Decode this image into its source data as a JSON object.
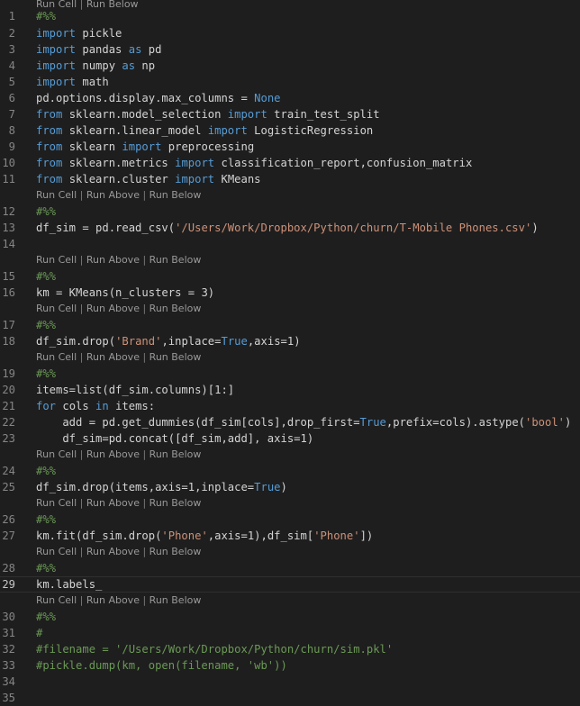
{
  "codelens": {
    "run_cell": "Run Cell",
    "run_above": "Run Above",
    "run_below": "Run Below",
    "separator": " | "
  },
  "lines": [
    {
      "n": "1",
      "toks": [
        {
          "t": "#%%",
          "c": "cm"
        }
      ]
    },
    {
      "n": "2",
      "toks": [
        {
          "t": "import",
          "c": "kw"
        },
        {
          "t": " pickle",
          "c": "plain"
        }
      ]
    },
    {
      "n": "3",
      "toks": [
        {
          "t": "import",
          "c": "kw"
        },
        {
          "t": " pandas ",
          "c": "plain"
        },
        {
          "t": "as",
          "c": "kw"
        },
        {
          "t": " pd",
          "c": "plain"
        }
      ]
    },
    {
      "n": "4",
      "toks": [
        {
          "t": "import",
          "c": "kw"
        },
        {
          "t": " numpy ",
          "c": "plain"
        },
        {
          "t": "as",
          "c": "kw"
        },
        {
          "t": " np",
          "c": "plain"
        }
      ]
    },
    {
      "n": "5",
      "toks": [
        {
          "t": "import",
          "c": "kw"
        },
        {
          "t": " math",
          "c": "plain"
        }
      ]
    },
    {
      "n": "6",
      "toks": [
        {
          "t": "pd.options.display.max_columns = ",
          "c": "plain"
        },
        {
          "t": "None",
          "c": "kw"
        }
      ]
    },
    {
      "n": "7",
      "toks": [
        {
          "t": "from",
          "c": "kw"
        },
        {
          "t": " sklearn.model_selection ",
          "c": "plain"
        },
        {
          "t": "import",
          "c": "kw"
        },
        {
          "t": " train_test_split",
          "c": "plain"
        }
      ]
    },
    {
      "n": "8",
      "toks": [
        {
          "t": "from",
          "c": "kw"
        },
        {
          "t": " sklearn.linear_model ",
          "c": "plain"
        },
        {
          "t": "import",
          "c": "kw"
        },
        {
          "t": " LogisticRegression",
          "c": "plain"
        }
      ]
    },
    {
      "n": "9",
      "toks": [
        {
          "t": "from",
          "c": "kw"
        },
        {
          "t": " sklearn ",
          "c": "plain"
        },
        {
          "t": "import",
          "c": "kw"
        },
        {
          "t": " preprocessing",
          "c": "plain"
        }
      ]
    },
    {
      "n": "10",
      "toks": [
        {
          "t": "from",
          "c": "kw"
        },
        {
          "t": " sklearn.metrics ",
          "c": "plain"
        },
        {
          "t": "import",
          "c": "kw"
        },
        {
          "t": " classification_report,confusion_matrix",
          "c": "plain"
        }
      ]
    },
    {
      "n": "11",
      "toks": [
        {
          "t": "from",
          "c": "kw"
        },
        {
          "t": " sklearn.cluster ",
          "c": "plain"
        },
        {
          "t": "import",
          "c": "kw"
        },
        {
          "t": " KMeans",
          "c": "plain"
        }
      ]
    },
    {
      "n": "12",
      "toks": [
        {
          "t": "#%%",
          "c": "cm"
        }
      ]
    },
    {
      "n": "13",
      "toks": [
        {
          "t": "df_sim = pd.read_csv(",
          "c": "plain"
        },
        {
          "t": "'/Users/Work/Dropbox/Python/churn/T-Mobile Phones.csv'",
          "c": "str"
        },
        {
          "t": ")",
          "c": "plain"
        }
      ]
    },
    {
      "n": "14",
      "toks": []
    },
    {
      "n": "15",
      "toks": [
        {
          "t": "#%%",
          "c": "cm"
        }
      ]
    },
    {
      "n": "16",
      "toks": [
        {
          "t": "km = KMeans(n_clusters = ",
          "c": "plain"
        },
        {
          "t": "3",
          "c": "plain"
        },
        {
          "t": ")",
          "c": "plain"
        }
      ]
    },
    {
      "n": "17",
      "toks": [
        {
          "t": "#%%",
          "c": "cm"
        }
      ]
    },
    {
      "n": "18",
      "toks": [
        {
          "t": "df_sim.drop(",
          "c": "plain"
        },
        {
          "t": "'Brand'",
          "c": "str"
        },
        {
          "t": ",inplace=",
          "c": "plain"
        },
        {
          "t": "True",
          "c": "kw"
        },
        {
          "t": ",axis=1)",
          "c": "plain"
        }
      ]
    },
    {
      "n": "19",
      "toks": [
        {
          "t": "#%%",
          "c": "cm"
        }
      ]
    },
    {
      "n": "20",
      "toks": [
        {
          "t": "items=list(df_sim.columns)[1:]",
          "c": "plain"
        }
      ]
    },
    {
      "n": "21",
      "toks": [
        {
          "t": "for",
          "c": "kw"
        },
        {
          "t": " cols ",
          "c": "plain"
        },
        {
          "t": "in",
          "c": "kw"
        },
        {
          "t": " items:",
          "c": "plain"
        }
      ]
    },
    {
      "n": "22",
      "toks": [
        {
          "t": "    add = pd.get_dummies(df_sim[cols],drop_first=",
          "c": "plain"
        },
        {
          "t": "True",
          "c": "kw"
        },
        {
          "t": ",prefix=cols).astype(",
          "c": "plain"
        },
        {
          "t": "'bool'",
          "c": "str"
        },
        {
          "t": ")",
          "c": "plain"
        }
      ]
    },
    {
      "n": "23",
      "toks": [
        {
          "t": "    df_sim=pd.concat([df_sim,add], axis=1)",
          "c": "plain"
        }
      ]
    },
    {
      "n": "24",
      "toks": [
        {
          "t": "#%%",
          "c": "cm"
        }
      ]
    },
    {
      "n": "25",
      "toks": [
        {
          "t": "df_sim.drop(items,axis=1,inplace=",
          "c": "plain"
        },
        {
          "t": "True",
          "c": "kw"
        },
        {
          "t": ")",
          "c": "plain"
        }
      ]
    },
    {
      "n": "26",
      "toks": [
        {
          "t": "#%%",
          "c": "cm"
        }
      ]
    },
    {
      "n": "27",
      "toks": [
        {
          "t": "km.fit(df_sim.drop(",
          "c": "plain"
        },
        {
          "t": "'Phone'",
          "c": "str"
        },
        {
          "t": ",axis=1),df_sim[",
          "c": "plain"
        },
        {
          "t": "'Phone'",
          "c": "str"
        },
        {
          "t": "])",
          "c": "plain"
        }
      ]
    },
    {
      "n": "28",
      "toks": [
        {
          "t": "#%%",
          "c": "cm"
        }
      ]
    },
    {
      "n": "29",
      "toks": [
        {
          "t": "km.labels_",
          "c": "plain"
        }
      ]
    },
    {
      "n": "30",
      "toks": [
        {
          "t": "#%%",
          "c": "cm"
        }
      ]
    },
    {
      "n": "31",
      "toks": [
        {
          "t": "#",
          "c": "cm"
        }
      ]
    },
    {
      "n": "32",
      "toks": [
        {
          "t": "#filename = '/Users/Work/Dropbox/Python/churn/sim.pkl'",
          "c": "cm"
        }
      ]
    },
    {
      "n": "33",
      "toks": [
        {
          "t": "#pickle.dump(km, open(filename, 'wb'))",
          "c": "cm"
        }
      ]
    },
    {
      "n": "34",
      "toks": []
    },
    {
      "n": "35",
      "toks": []
    }
  ]
}
